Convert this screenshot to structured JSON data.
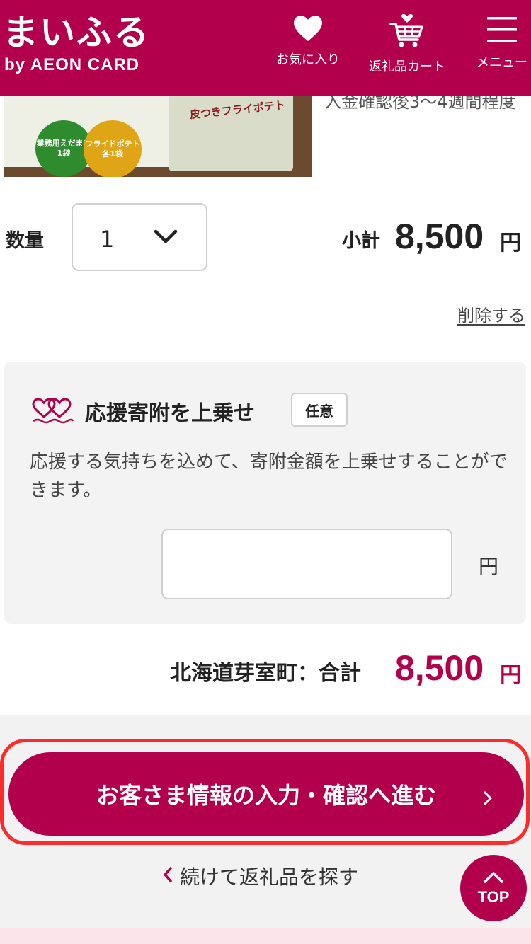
{
  "header": {
    "logo_title": "まいふる",
    "logo_subtitle": "by AEON CARD",
    "favorites_label": "お気に入り",
    "cart_label": "返礼品カート",
    "menu_label": "メニュー",
    "brand_color": "#b3004c"
  },
  "product": {
    "image_text_bag": "皮つきフライポテト",
    "image_badge_green": "業務用えだまめ1袋",
    "image_badge_yellow": "フライドポテト各1袋",
    "delivery_text": "入金確認後3〜4週間程度"
  },
  "quantity": {
    "label": "数量",
    "value": "1",
    "subtotal_label": "小計",
    "subtotal_value": "8,500",
    "currency": "円",
    "delete_label": "削除する"
  },
  "extra_donation": {
    "title": "応援寄附を上乗せ",
    "optional_tag": "任意",
    "description": "応援する気持ちを込めて、寄附金額を上乗せすることができます。",
    "input_value": "",
    "unit": "円"
  },
  "total": {
    "label": "北海道芽室町：合計",
    "value": "8,500",
    "unit": "円"
  },
  "actions": {
    "proceed_label": "お客さま情報の入力・確認へ進む",
    "continue_label": "続けて返礼品を探す",
    "top_label": "TOP"
  }
}
